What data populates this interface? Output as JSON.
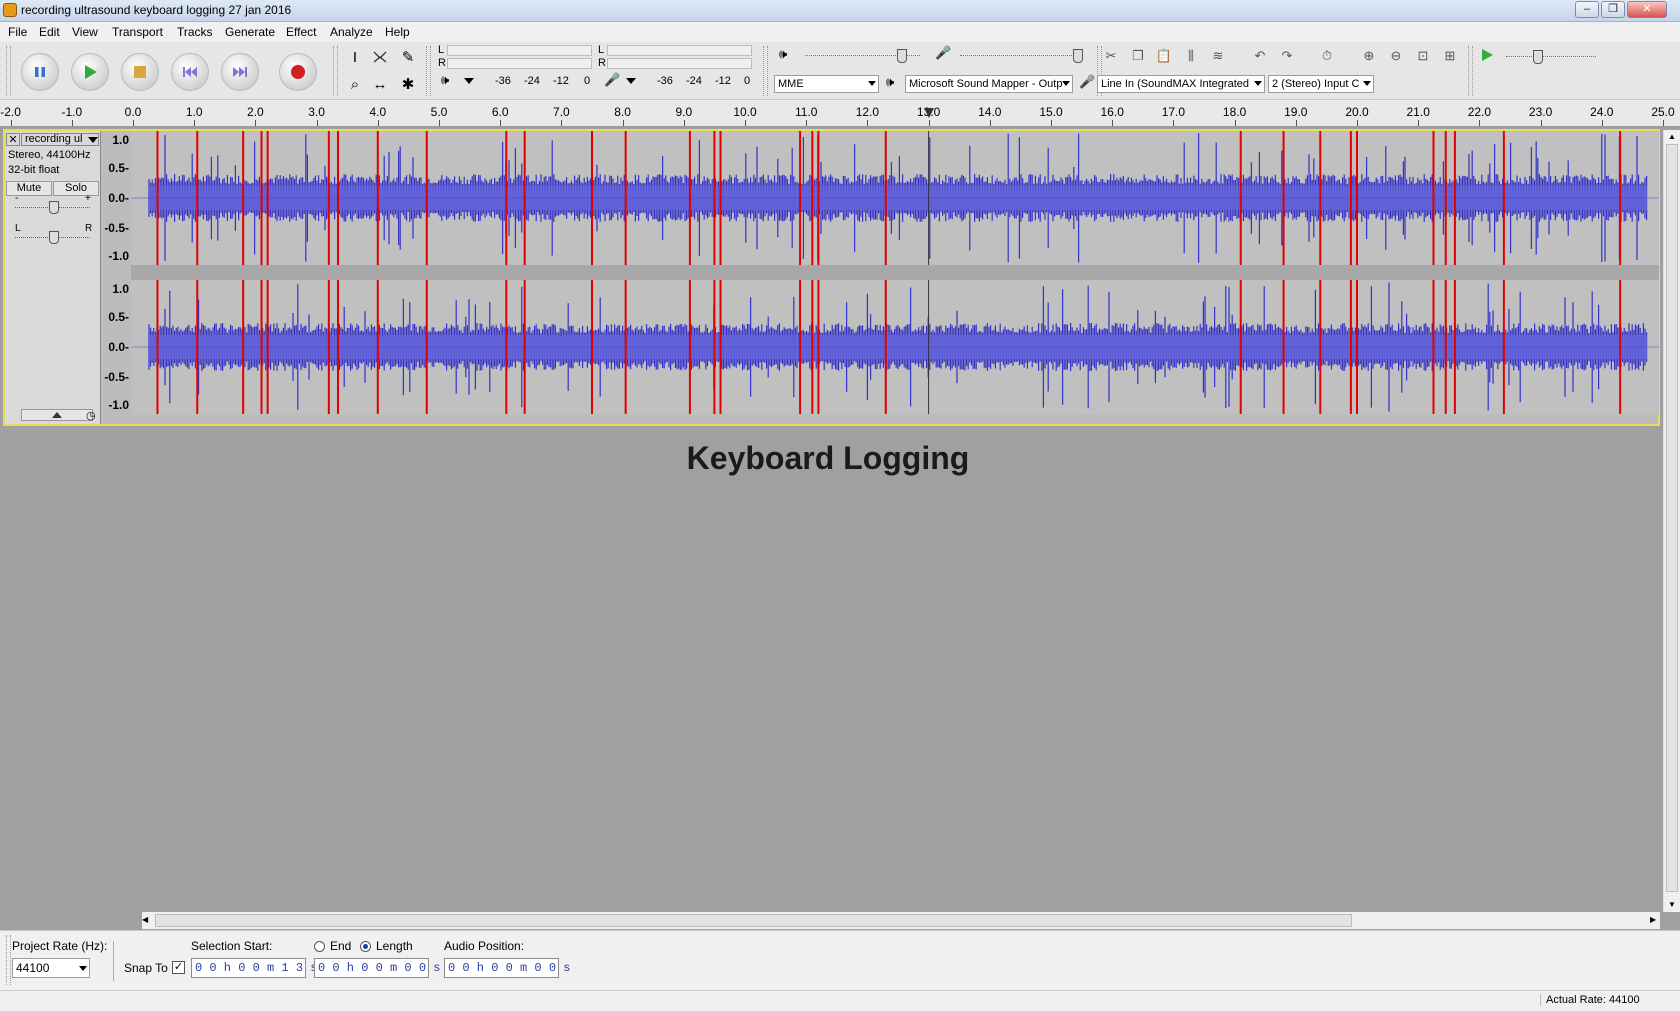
{
  "window": {
    "title": "recording ultrasound keyboard logging 27 jan 2016",
    "min": "–",
    "max": "❐",
    "close": "✕"
  },
  "menu": [
    "File",
    "Edit",
    "View",
    "Transport",
    "Tracks",
    "Generate",
    "Effect",
    "Analyze",
    "Help"
  ],
  "meters": {
    "play_L": "L",
    "play_R": "R",
    "rec_L": "L",
    "rec_R": "R",
    "scale": [
      "-36",
      "-24",
      "-12",
      "0"
    ]
  },
  "devices": {
    "host": "MME",
    "output": "Microsoft Sound Mapper - Outp",
    "input": "Line In (SoundMAX Integrated",
    "channels": "2 (Stereo) Input C"
  },
  "ruler": {
    "labels": [
      "-2.0",
      "-1.0",
      "0.0",
      "1.0",
      "2.0",
      "3.0",
      "4.0",
      "5.0",
      "6.0",
      "7.0",
      "8.0",
      "9.0",
      "10.0",
      "11.0",
      "12.0",
      "13.0",
      "14.0",
      "15.0",
      "16.0",
      "17.0",
      "18.0",
      "19.0",
      "20.0",
      "21.0",
      "22.0",
      "23.0",
      "24.0",
      "25.0"
    ],
    "playhead_seconds": 13.0
  },
  "track": {
    "name": "recording ul",
    "info_line1": "Stereo, 44100Hz",
    "info_line2": "32-bit float",
    "mute": "Mute",
    "solo": "Solo",
    "gain_minus": "-",
    "gain_plus": "+",
    "pan_left": "L",
    "pan_right": "R",
    "vscale": [
      "1.0",
      "0.5-",
      "0.0-",
      "-0.5-",
      "-1.0"
    ],
    "label_markers_seconds": [
      0.4,
      1.05,
      1.8,
      2.1,
      2.2,
      3.2,
      3.35,
      4.0,
      4.8,
      6.1,
      6.4,
      7.5,
      8.05,
      9.1,
      9.5,
      9.6,
      10.9,
      11.1,
      11.2,
      12.3,
      18.1,
      18.8,
      19.4,
      19.9,
      20.0,
      21.25,
      21.45,
      21.6,
      22.4,
      24.3
    ],
    "label_text": "Keyboard Logging"
  },
  "selection_bar": {
    "project_rate_label": "Project Rate (Hz):",
    "project_rate": "44100",
    "snap_to_label": "Snap To",
    "snap_checked": "✓",
    "selection_start_label": "Selection Start:",
    "end_label": "End",
    "length_label": "Length",
    "audio_position_label": "Audio Position:",
    "selection_start_value": "0 0 h 0 0 m 1 3 s",
    "length_value": "0 0 h 0 0 m 0 0 s",
    "audio_position_value": "0 0 h 0 0 m 0 0 s"
  },
  "status": {
    "actual_rate": "Actual Rate: 44100"
  },
  "colors": {
    "waveform": "#3232c8",
    "waveform_rms": "#6464dc",
    "label_line": "#e00000",
    "track_border": "#e7de58"
  }
}
